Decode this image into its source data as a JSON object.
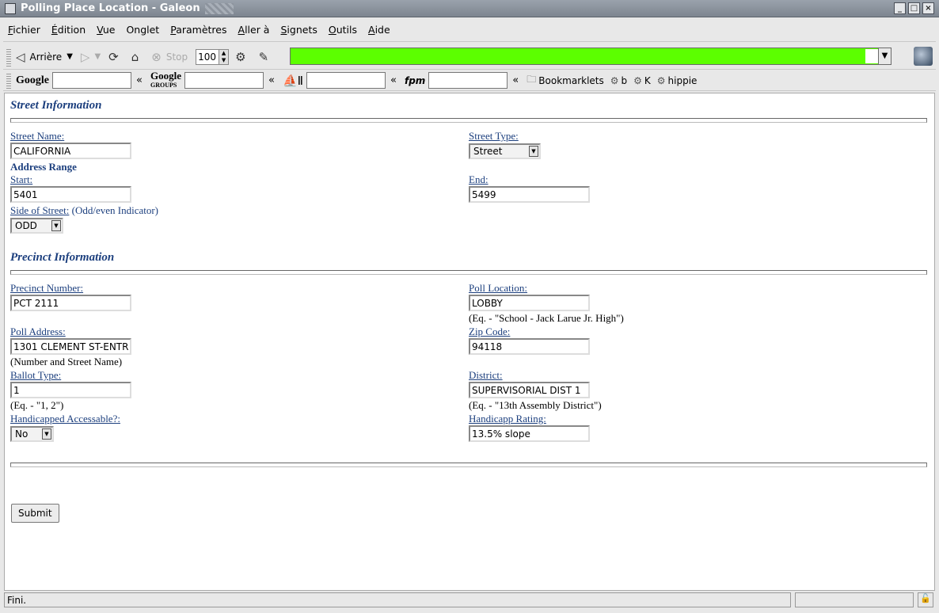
{
  "window": {
    "title": "Polling Place Location - Galeon"
  },
  "menu": [
    {
      "label": "Fichier",
      "mn": "F",
      "rest": "ichier"
    },
    {
      "label": "Édition",
      "mn": "É",
      "rest": "dition"
    },
    {
      "label": "Vue",
      "mn": "V",
      "rest": "ue"
    },
    {
      "label": "Onglet",
      "mn": "",
      "rest": "Onglet"
    },
    {
      "label": "Paramètres",
      "mn": "P",
      "rest": "aramètres"
    },
    {
      "label": "Aller à",
      "mn": "A",
      "rest": "ller à"
    },
    {
      "label": "Signets",
      "mn": "S",
      "rest": "ignets"
    },
    {
      "label": "Outils",
      "mn": "O",
      "rest": "utils"
    },
    {
      "label": "Aide",
      "mn": "A",
      "rest": "ide"
    }
  ],
  "toolbar": {
    "back_label": "Arrière",
    "stop_label": "Stop",
    "zoom": "100"
  },
  "searchbar": {
    "google": "Google",
    "google_groups": "Google",
    "groups_sub": "GROUPS",
    "fpm": "fpm",
    "chevron": "«",
    "bookmarklets": "Bookmarklets",
    "bm_b": "b",
    "bm_k": "K",
    "bm_hippie": "hippie"
  },
  "street": {
    "title": "Street Information",
    "name_label": "Street Name:",
    "name_value": "CALIFORNIA",
    "type_label": "Street Type:",
    "type_value": "Street",
    "range_label": "Address Range",
    "start_label": "Start:",
    "start_value": "5401",
    "end_label": "End:",
    "end_value": "5499",
    "side_label": "Side of Street:",
    "side_note": " (Odd/even Indicator)",
    "side_value": "ODD"
  },
  "precinct": {
    "title": "Precinct Information",
    "number_label": "Precinct Number:",
    "number_value": "PCT 2111",
    "location_label": "Poll Location:",
    "location_value": "LOBBY",
    "location_note": "(Eq. - \"School - Jack Larue Jr. High\")",
    "address_label": "Poll Address:",
    "address_value": "1301 CLEMENT ST-ENTR",
    "address_note": "(Number and Street Name)",
    "zip_label": "Zip Code:",
    "zip_value": "94118",
    "ballot_label": "Ballot Type:",
    "ballot_value": "1",
    "ballot_note": "(Eq. - \"1, 2\")",
    "district_label": "District:",
    "district_value": "SUPERVISORIAL DIST 1",
    "district_note": "(Eq. - \"13th Assembly District\")",
    "accessible_label": "Handicapped Accessable?:",
    "accessible_value": "No",
    "rating_label": "Handicapp Rating:",
    "rating_value": "13.5% slope"
  },
  "submit_label": "Submit",
  "status": {
    "text": "Fini."
  }
}
